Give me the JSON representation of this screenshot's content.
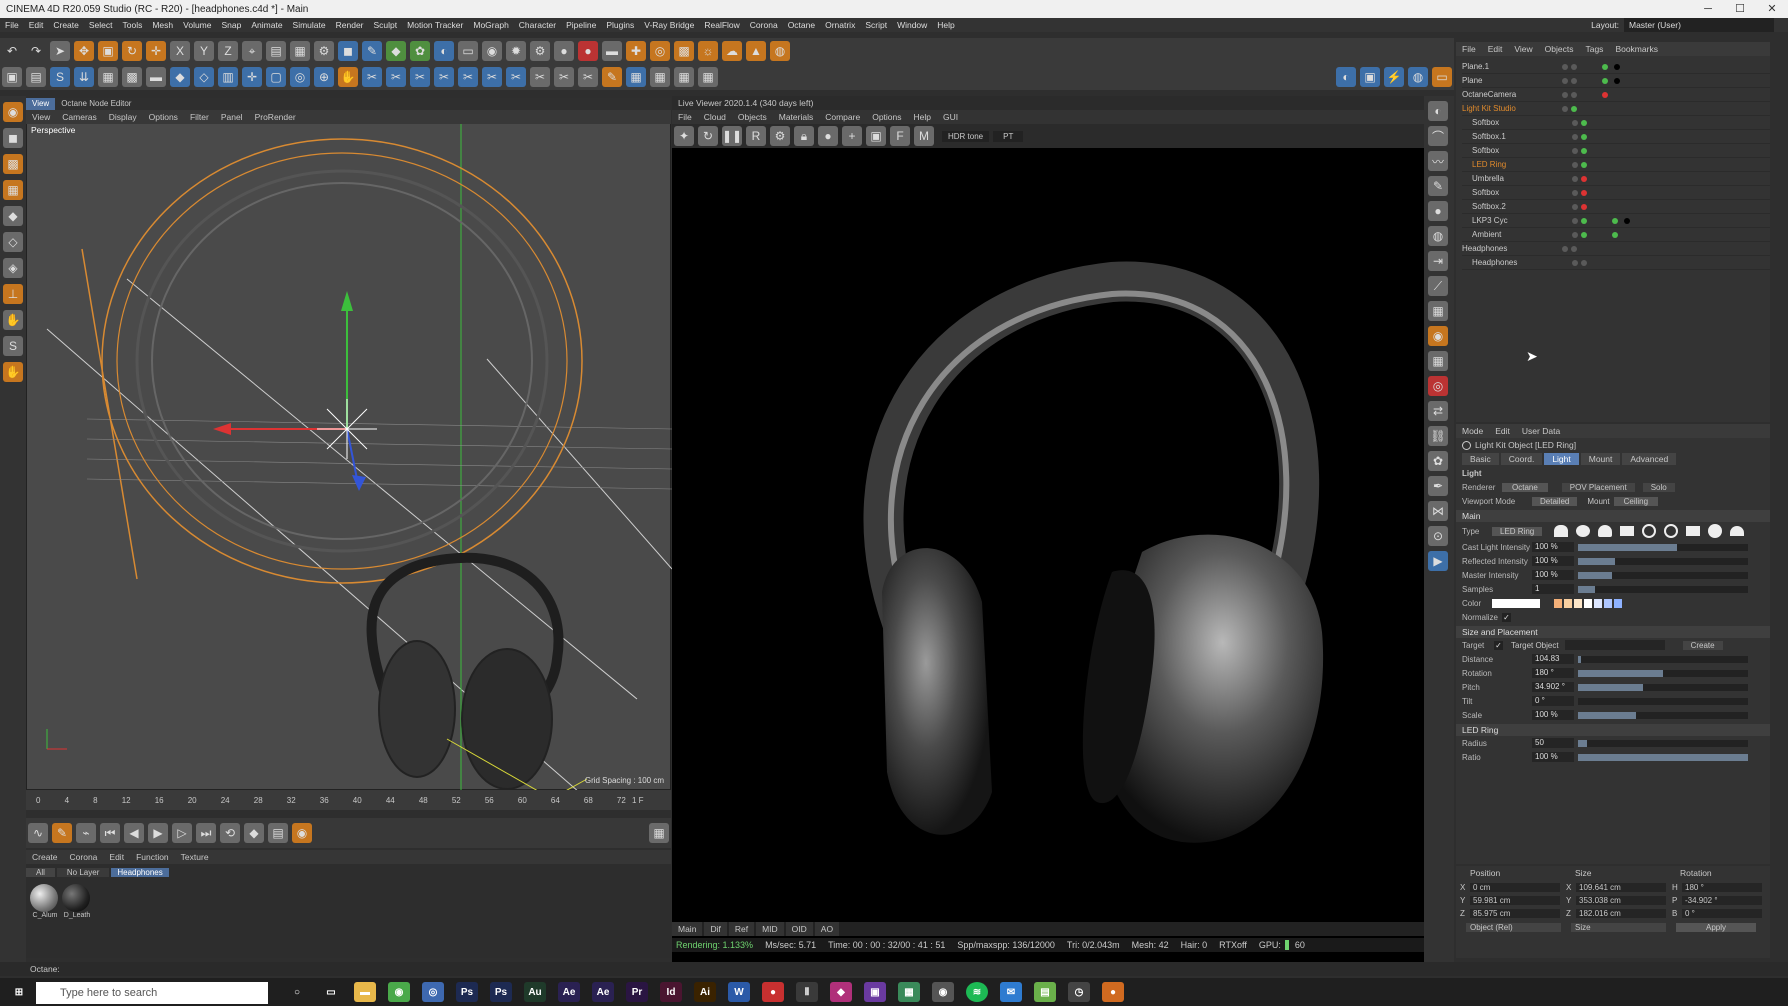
{
  "window": {
    "title": "CINEMA 4D R20.059 Studio (RC - R20) - [headphones.c4d *] - Main",
    "minimize": "─",
    "maximize": "☐",
    "close": "✕"
  },
  "menu": [
    "File",
    "Edit",
    "Create",
    "Select",
    "Tools",
    "Mesh",
    "Volume",
    "Snap",
    "Animate",
    "Simulate",
    "Render",
    "Sculpt",
    "Motion Tracker",
    "MoGraph",
    "Character",
    "Pipeline",
    "Plugins",
    "V-Ray Bridge",
    "RealFlow",
    "Corona",
    "Octane",
    "Ornatrix",
    "Script",
    "Window",
    "Help"
  ],
  "layout": {
    "label": "Layout:",
    "value": "Master (User)"
  },
  "viewport": {
    "tabs": [
      "View",
      "Octane Node Editor"
    ],
    "menu": [
      "View",
      "Cameras",
      "Display",
      "Options",
      "Filter",
      "Panel",
      "ProRender"
    ],
    "label": "Perspective",
    "grid_spacing": "Grid Spacing : 100 cm"
  },
  "timeline": {
    "ticks": [
      "0",
      "4",
      "8",
      "12",
      "16",
      "20",
      "24",
      "28",
      "32",
      "36",
      "40",
      "44",
      "48",
      "52",
      "56",
      "60",
      "64",
      "68",
      "72"
    ],
    "current": "1 F"
  },
  "material_manager": {
    "menu": [
      "Create",
      "Corona",
      "Edit",
      "Function",
      "Texture"
    ],
    "filters": [
      "All",
      "No Layer",
      "Headphones"
    ],
    "materials": [
      "C_Alum",
      "D_Leath"
    ]
  },
  "live_viewer": {
    "title": "Live Viewer 2020.1.4 (340 days left)",
    "menu": [
      "File",
      "Cloud",
      "Objects",
      "Materials",
      "Compare",
      "Options",
      "Help",
      "GUI"
    ],
    "tone": "HDR tone",
    "pt": "PT",
    "channels": [
      "Main",
      "Dif",
      "Ref",
      "MID",
      "OID",
      "AO"
    ],
    "status": {
      "rendering": "Rendering: 1.133%",
      "mssec": "Ms/sec: 5.71",
      "time": "Time: 00 : 00 : 32/00 : 41 : 51",
      "spp": "Spp/maxspp: 136/12000",
      "tri": "Tri: 0/2.043m",
      "mesh": "Mesh: 42",
      "hair": "Hair: 0",
      "rtx": "RTXoff",
      "gpu": "GPU:",
      "gpu_val": "60"
    }
  },
  "object_manager": {
    "menu": [
      "File",
      "Edit",
      "View",
      "Objects",
      "Tags",
      "Bookmarks"
    ],
    "objects": [
      {
        "name": "Plane.1",
        "color": "#cfcfcf"
      },
      {
        "name": "Plane",
        "color": "#cfcfcf"
      },
      {
        "name": "OctaneCamera",
        "color": "#cfcfcf"
      },
      {
        "name": "Light Kit Studio",
        "color": "#e08a2c"
      },
      {
        "name": "Softbox",
        "color": "#cfcfcf"
      },
      {
        "name": "Softbox.1",
        "color": "#cfcfcf"
      },
      {
        "name": "Softbox",
        "color": "#cfcfcf"
      },
      {
        "name": "LED Ring",
        "color": "#e08a2c"
      },
      {
        "name": "Umbrella",
        "color": "#cfcfcf"
      },
      {
        "name": "Softbox",
        "color": "#cfcfcf"
      },
      {
        "name": "Softbox.2",
        "color": "#cfcfcf"
      },
      {
        "name": "LKP3 Cyc",
        "color": "#cfcfcf"
      },
      {
        "name": "Ambient",
        "color": "#cfcfcf"
      },
      {
        "name": "Headphones",
        "color": "#cfcfcf"
      },
      {
        "name": "Headphones",
        "color": "#cfcfcf"
      }
    ]
  },
  "attributes": {
    "menu": [
      "Mode",
      "Edit",
      "User Data"
    ],
    "object_title": "Light Kit Object [LED Ring]",
    "tabs": [
      "Basic",
      "Coord.",
      "Light",
      "Mount",
      "Advanced"
    ],
    "active_tab": "Light",
    "light": {
      "section": "Light",
      "renderer_label": "Renderer",
      "renderer": "Octane",
      "pov": "POV Placement",
      "solo": "Solo",
      "viewport_mode_label": "Viewport Mode",
      "viewport_mode": "Detailed",
      "mount_label": "Mount",
      "mount": "Ceiling"
    },
    "main": {
      "section": "Main",
      "type_label": "Type",
      "type": "LED Ring",
      "rows": [
        {
          "label": "Cast Light Intensity",
          "value": "100 %",
          "level": 0.58
        },
        {
          "label": "Reflected Intensity",
          "value": "100 %",
          "level": 0.22
        },
        {
          "label": "Master Intensity",
          "value": "100 %",
          "level": 0.2
        },
        {
          "label": "Samples",
          "value": "1",
          "level": 0.1
        }
      ],
      "color_label": "Color",
      "normalize_label": "Normalize"
    },
    "size": {
      "section": "Size and Placement",
      "target_label": "Target",
      "target_object_label": "Target Object",
      "create": "Create",
      "rows": [
        {
          "label": "Distance",
          "value": "104.83",
          "level": 0.02
        },
        {
          "label": "Rotation",
          "value": "180 °",
          "level": 0.5
        },
        {
          "label": "Pitch",
          "value": "34.902 °",
          "level": 0.38
        },
        {
          "label": "Tilt",
          "value": "0 °",
          "level": 0.0
        },
        {
          "label": "Scale",
          "value": "100 %",
          "level": 0.34
        }
      ]
    },
    "ring": {
      "section": "LED Ring",
      "rows": [
        {
          "label": "Radius",
          "value": "50",
          "level": 0.05
        },
        {
          "label": "Ratio",
          "value": "100 %",
          "level": 1.0
        }
      ]
    }
  },
  "coordinates": {
    "headers": [
      "Position",
      "Size",
      "Rotation"
    ],
    "rows": [
      {
        "a": "X",
        "pos": "0 cm",
        "b": "X",
        "size": "109.641 cm",
        "c": "H",
        "rot": "180 °"
      },
      {
        "a": "Y",
        "pos": "59.981 cm",
        "b": "Y",
        "size": "353.038 cm",
        "c": "P",
        "rot": "-34.902 °"
      },
      {
        "a": "Z",
        "pos": "85.975 cm",
        "b": "Z",
        "size": "182.016 cm",
        "c": "B",
        "rot": "0 °"
      }
    ],
    "mode": "Object (Rel)",
    "size_mode": "Size",
    "apply": "Apply"
  },
  "status_text": "Octane:",
  "taskbar": {
    "search_placeholder": "Type here to search"
  }
}
